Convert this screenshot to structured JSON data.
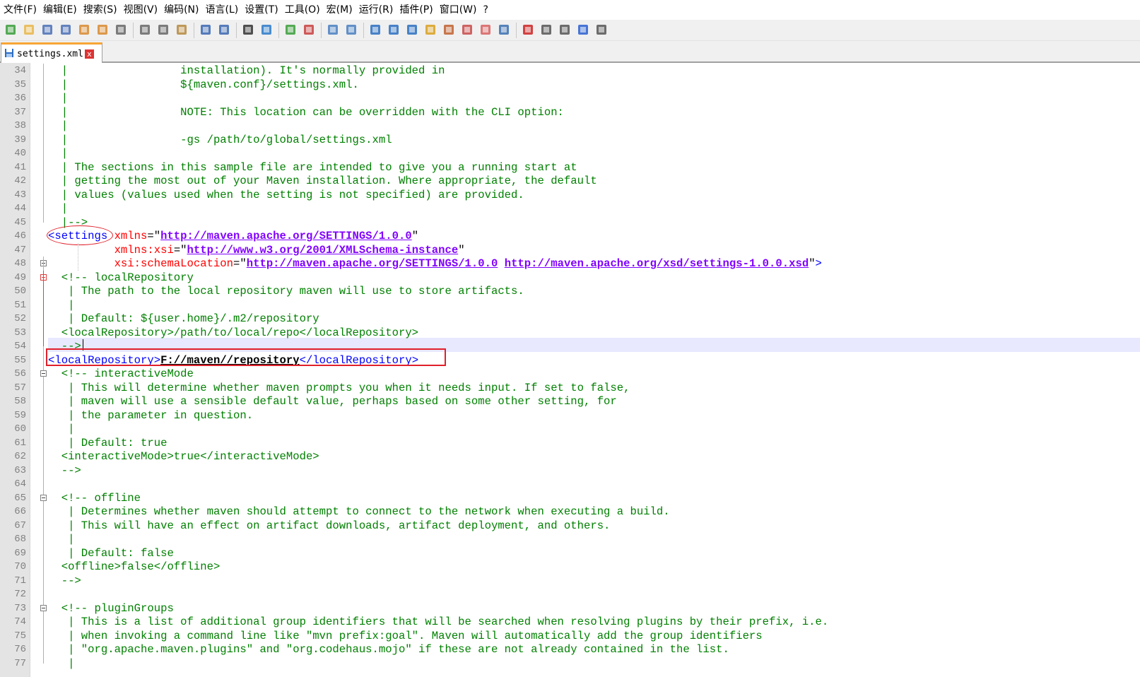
{
  "menu": [
    "文件(F)",
    "编辑(E)",
    "搜索(S)",
    "视图(V)",
    "编码(N)",
    "语言(L)",
    "设置(T)",
    "工具(O)",
    "宏(M)",
    "运行(R)",
    "插件(P)",
    "窗口(W)",
    "?"
  ],
  "toolbar": {
    "buttons": [
      "new-file-icon",
      "open-file-icon",
      "save-icon",
      "save-all-icon",
      "close-icon",
      "close-all-icon",
      "print-icon",
      "cut-icon",
      "copy-icon",
      "paste-icon",
      "undo-icon",
      "redo-icon",
      "find-icon",
      "replace-icon",
      "zoom-in-icon",
      "zoom-out-icon",
      "sync-vertical-icon",
      "sync-horizontal-icon",
      "word-wrap-icon",
      "show-all-chars-icon",
      "indent-guide-icon",
      "language-icon",
      "function-list-icon",
      "doc-map-icon",
      "folder-as-workspace-icon",
      "monitor-icon",
      "record-macro-icon",
      "stop-record-icon",
      "play-macro-icon",
      "play-multiple-icon",
      "save-macro-icon"
    ]
  },
  "tab": {
    "label": "settings.xml",
    "close": "x"
  },
  "colors": {
    "comment": "#008000",
    "tag": "#0000ff",
    "attr": "#ff0000",
    "url": "#8000ff",
    "highlight_box": "#e0202a"
  },
  "lines": [
    {
      "n": "34",
      "segs": [
        {
          "c": "cm",
          "t": "  |                 installation). It's normally provided in"
        }
      ]
    },
    {
      "n": "35",
      "segs": [
        {
          "c": "cm",
          "t": "  |                 ${maven.conf}/settings.xml."
        }
      ]
    },
    {
      "n": "36",
      "segs": [
        {
          "c": "cm",
          "t": "  |"
        }
      ]
    },
    {
      "n": "37",
      "segs": [
        {
          "c": "cm",
          "t": "  |                 NOTE: This location can be overridden with the CLI option:"
        }
      ]
    },
    {
      "n": "38",
      "segs": [
        {
          "c": "cm",
          "t": "  |"
        }
      ]
    },
    {
      "n": "39",
      "segs": [
        {
          "c": "cm",
          "t": "  |                 -gs /path/to/global/settings.xml"
        }
      ]
    },
    {
      "n": "40",
      "segs": [
        {
          "c": "cm",
          "t": "  |"
        }
      ]
    },
    {
      "n": "41",
      "segs": [
        {
          "c": "cm",
          "t": "  | The sections in this sample file are intended to give you a running start at"
        }
      ]
    },
    {
      "n": "42",
      "segs": [
        {
          "c": "cm",
          "t": "  | getting the most out of your Maven installation. Where appropriate, the default"
        }
      ]
    },
    {
      "n": "43",
      "segs": [
        {
          "c": "cm",
          "t": "  | values (values used when the setting is not specified) are provided."
        }
      ]
    },
    {
      "n": "44",
      "segs": [
        {
          "c": "cm",
          "t": "  |"
        }
      ]
    },
    {
      "n": "45",
      "segs": [
        {
          "c": "cm",
          "t": "  |-->"
        }
      ]
    },
    {
      "n": "46",
      "segs": [
        {
          "c": "tg",
          "t": "<settings "
        },
        {
          "c": "at",
          "t": "xmlns"
        },
        {
          "c": "tx",
          "t": "=\""
        },
        {
          "c": "ur",
          "t": "http://maven.apache.org/SETTINGS/1.0.0"
        },
        {
          "c": "tx",
          "t": "\""
        }
      ]
    },
    {
      "n": "47",
      "segs": [
        {
          "c": "tx",
          "t": "          "
        },
        {
          "c": "at",
          "t": "xmlns:xsi"
        },
        {
          "c": "tx",
          "t": "=\""
        },
        {
          "c": "ur",
          "t": "http://www.w3.org/2001/XMLSchema-instance"
        },
        {
          "c": "tx",
          "t": "\""
        }
      ]
    },
    {
      "n": "48",
      "segs": [
        {
          "c": "tx",
          "t": "          "
        },
        {
          "c": "at",
          "t": "xsi:schemaLocation"
        },
        {
          "c": "tx",
          "t": "=\""
        },
        {
          "c": "ur",
          "t": "http://maven.apache.org/SETTINGS/1.0.0"
        },
        {
          "c": "tx",
          "t": " "
        },
        {
          "c": "ur",
          "t": "http://maven.apache.org/xsd/settings-1.0.0.xsd"
        },
        {
          "c": "tx",
          "t": "\""
        },
        {
          "c": "tg",
          "t": ">"
        }
      ]
    },
    {
      "n": "49",
      "segs": [
        {
          "c": "cm",
          "t": "  <!-- localRepository"
        }
      ]
    },
    {
      "n": "50",
      "segs": [
        {
          "c": "cm",
          "t": "   | The path to the local repository maven will use to store artifacts."
        }
      ]
    },
    {
      "n": "51",
      "segs": [
        {
          "c": "cm",
          "t": "   |"
        }
      ]
    },
    {
      "n": "52",
      "segs": [
        {
          "c": "cm",
          "t": "   | Default: ${user.home}/.m2/repository"
        }
      ]
    },
    {
      "n": "53",
      "segs": [
        {
          "c": "cm",
          "t": "  <localRepository>/path/to/local/repo</localRepository>"
        }
      ]
    },
    {
      "n": "54",
      "segs": [
        {
          "c": "cm",
          "t": "  -->"
        }
      ]
    },
    {
      "n": "55",
      "segs": [
        {
          "c": "tg",
          "t": "<localRepository>"
        },
        {
          "c": "bu",
          "t": "F://maven//repository"
        },
        {
          "c": "tg",
          "t": "</localRepository>"
        }
      ]
    },
    {
      "n": "56",
      "segs": [
        {
          "c": "cm",
          "t": "  <!-- interactiveMode"
        }
      ]
    },
    {
      "n": "57",
      "segs": [
        {
          "c": "cm",
          "t": "   | This will determine whether maven prompts you when it needs input. If set to false,"
        }
      ]
    },
    {
      "n": "58",
      "segs": [
        {
          "c": "cm",
          "t": "   | maven will use a sensible default value, perhaps based on some other setting, for"
        }
      ]
    },
    {
      "n": "59",
      "segs": [
        {
          "c": "cm",
          "t": "   | the parameter in question."
        }
      ]
    },
    {
      "n": "60",
      "segs": [
        {
          "c": "cm",
          "t": "   |"
        }
      ]
    },
    {
      "n": "61",
      "segs": [
        {
          "c": "cm",
          "t": "   | Default: true"
        }
      ]
    },
    {
      "n": "62",
      "segs": [
        {
          "c": "cm",
          "t": "  <interactiveMode>true</interactiveMode>"
        }
      ]
    },
    {
      "n": "63",
      "segs": [
        {
          "c": "cm",
          "t": "  -->"
        }
      ]
    },
    {
      "n": "64",
      "segs": [
        {
          "c": "tx",
          "t": ""
        }
      ]
    },
    {
      "n": "65",
      "segs": [
        {
          "c": "cm",
          "t": "  <!-- offline"
        }
      ]
    },
    {
      "n": "66",
      "segs": [
        {
          "c": "cm",
          "t": "   | Determines whether maven should attempt to connect to the network when executing a build."
        }
      ]
    },
    {
      "n": "67",
      "segs": [
        {
          "c": "cm",
          "t": "   | This will have an effect on artifact downloads, artifact deployment, and others."
        }
      ]
    },
    {
      "n": "68",
      "segs": [
        {
          "c": "cm",
          "t": "   |"
        }
      ]
    },
    {
      "n": "69",
      "segs": [
        {
          "c": "cm",
          "t": "   | Default: false"
        }
      ]
    },
    {
      "n": "70",
      "segs": [
        {
          "c": "cm",
          "t": "  <offline>false</offline>"
        }
      ]
    },
    {
      "n": "71",
      "segs": [
        {
          "c": "cm",
          "t": "  -->"
        }
      ]
    },
    {
      "n": "72",
      "segs": [
        {
          "c": "tx",
          "t": ""
        }
      ]
    },
    {
      "n": "73",
      "segs": [
        {
          "c": "cm",
          "t": "  <!-- pluginGroups"
        }
      ]
    },
    {
      "n": "74",
      "segs": [
        {
          "c": "cm",
          "t": "   | This is a list of additional group identifiers that will be searched when resolving plugins by their prefix, i.e."
        }
      ]
    },
    {
      "n": "75",
      "segs": [
        {
          "c": "cm",
          "t": "   | when invoking a command line like \"mvn prefix:goal\". Maven will automatically add the group identifiers"
        }
      ]
    },
    {
      "n": "76",
      "segs": [
        {
          "c": "cm",
          "t": "   | \"org.apache.maven.plugins\" and \"org.codehaus.mojo\" if these are not already contained in the list."
        }
      ]
    },
    {
      "n": "77",
      "segs": [
        {
          "c": "cm",
          "t": "   |"
        }
      ]
    }
  ]
}
